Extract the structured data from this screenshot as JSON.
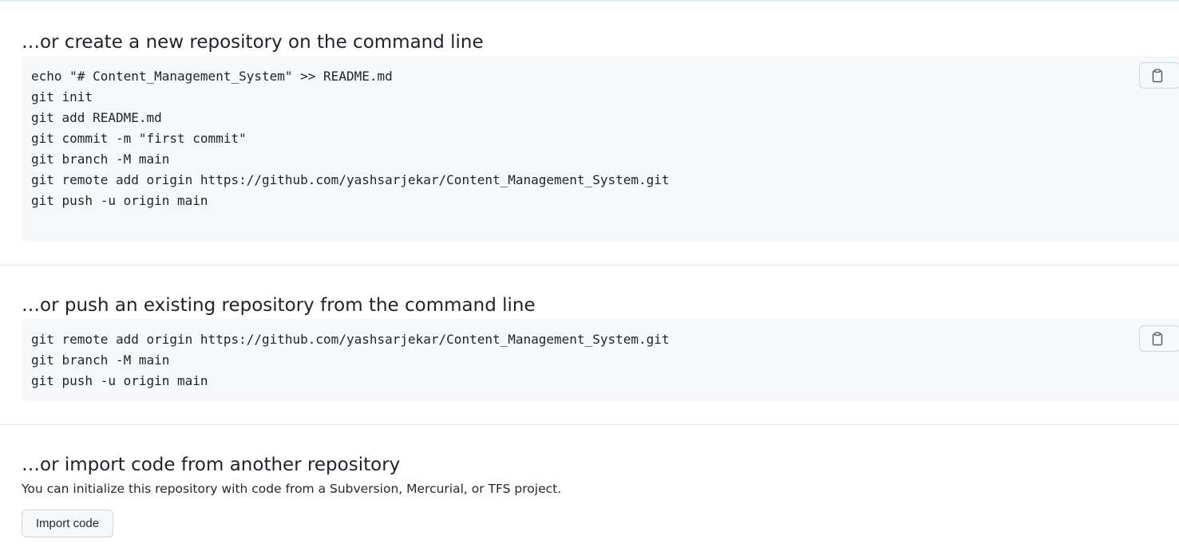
{
  "sections": {
    "create_new": {
      "heading": "…or create a new repository on the command line",
      "lines": [
        "echo \"# Content_Management_System\" >> README.md",
        "git init",
        "git add README.md",
        "git commit -m \"first commit\"",
        "git branch -M main",
        "git remote add origin https://github.com/yashsarjekar/Content_Management_System.git",
        "git push -u origin main"
      ],
      "copy_icon": "clipboard-icon"
    },
    "push_existing": {
      "heading": "…or push an existing repository from the command line",
      "lines": [
        "git remote add origin https://github.com/yashsarjekar/Content_Management_System.git",
        "git branch -M main",
        "git push -u origin main"
      ],
      "copy_icon": "clipboard-icon"
    },
    "import_code": {
      "heading": "…or import code from another repository",
      "description": "You can initialize this repository with code from a Subversion, Mercurial, or TFS project.",
      "button_label": "Import code"
    }
  },
  "colors": {
    "code_background": "#f6f8fa",
    "border": "#d0d7de",
    "text": "#1f2328",
    "top_rule": "#d8eef8"
  }
}
